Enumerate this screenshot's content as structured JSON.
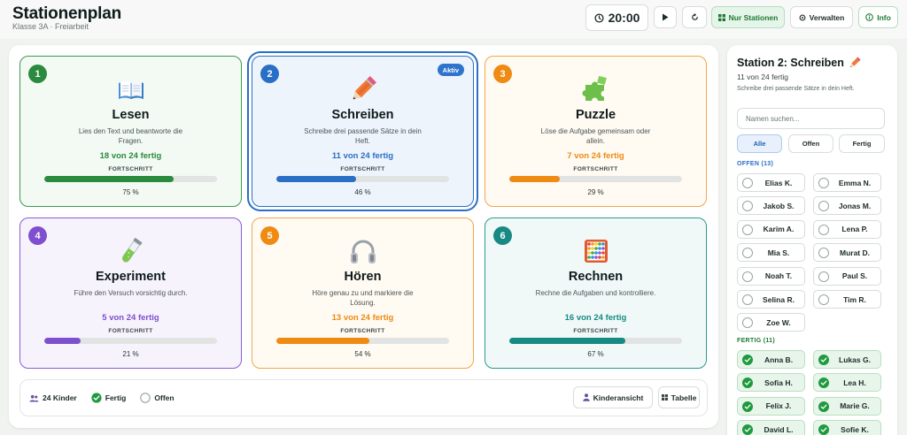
{
  "header": {
    "title": "Stationenplan",
    "subtitle": "Klasse 3A · Freiarbeit",
    "timer": "20:00",
    "only_stations_label": "Nur Stationen",
    "manage_label": "Verwalten",
    "info_label": "Info"
  },
  "stations": [
    {
      "number": "1",
      "name": "Lesen",
      "description": "Lies den Text und beantworte die Fragen.",
      "done_text": "18 von 24 fertig",
      "progress_label": "FORTSCHRITT",
      "percent_text": "75 %",
      "progress": 0.75,
      "icon": "book-icon",
      "color": "#2a8a3e",
      "bg": "#f3faf3",
      "border": "#3c9a4e"
    },
    {
      "number": "2",
      "name": "Schreiben",
      "description": "Schreibe drei passende Sätze in dein Heft.",
      "done_text": "11 von 24 fertig",
      "progress_label": "FORTSCHRITT",
      "percent_text": "46 %",
      "progress": 0.46,
      "icon": "pencil-icon",
      "color": "#2a6fc6",
      "bg": "#eef4fc",
      "border": "#2a6fc6",
      "active": true,
      "active_label": "Aktiv"
    },
    {
      "number": "3",
      "name": "Puzzle",
      "description": "Löse die Aufgabe gemeinsam oder allein.",
      "done_text": "7 von 24 fertig",
      "progress_label": "FORTSCHRITT",
      "percent_text": "29 %",
      "progress": 0.29,
      "icon": "puzzle-icon",
      "color": "#ef8a12",
      "bg": "#fffaf2",
      "border": "#f2a64a"
    },
    {
      "number": "4",
      "name": "Experiment",
      "description": "Führe den Versuch vorsichtig durch.",
      "done_text": "5 von 24 fertig",
      "progress_label": "FORTSCHRITT",
      "percent_text": "21 %",
      "progress": 0.21,
      "icon": "test-tube-icon",
      "color": "#7e4fcf",
      "bg": "#f7f3fd",
      "border": "#8a5bd6"
    },
    {
      "number": "5",
      "name": "Hören",
      "description": "Höre genau zu und markiere die Lösung.",
      "done_text": "13 von 24 fertig",
      "progress_label": "FORTSCHRITT",
      "percent_text": "54 %",
      "progress": 0.54,
      "icon": "headphones-icon",
      "color": "#ef8a12",
      "bg": "#fffaf2",
      "border": "#f2a64a"
    },
    {
      "number": "6",
      "name": "Rechnen",
      "description": "Rechne die Aufgaben und kontrolliere.",
      "done_text": "16 von 24 fertig",
      "progress_label": "FORTSCHRITT",
      "percent_text": "67 %",
      "progress": 0.67,
      "icon": "abacus-icon",
      "color": "#178a83",
      "bg": "#f0f9f8",
      "border": "#2a9a91"
    }
  ],
  "bottom": {
    "kids_count": "24 Kinder",
    "legend_done": "Fertig",
    "legend_open": "Offen",
    "kids_view_label": "Kinderansicht",
    "table_label": "Tabelle"
  },
  "side": {
    "title": "Station 2: Schreiben",
    "count": "11 von 24 fertig",
    "task": "Schreibe drei passende Sätze in dein Heft.",
    "search_placeholder": "Namen suchen...",
    "filters": [
      "Alle",
      "Offen",
      "Fertig"
    ],
    "open_label": "OFFEN (13)",
    "done_label": "FERTIG (11)",
    "open_kids": [
      "Elias K.",
      "Emma N.",
      "Jakob S.",
      "Jonas M.",
      "Karim A.",
      "Lena P.",
      "Mia S.",
      "Murat D.",
      "Noah T.",
      "Paul S.",
      "Selina R.",
      "Tim R.",
      "Zoe W."
    ],
    "done_kids": [
      "Anna B.",
      "Lukas G.",
      "Sofia H.",
      "Lea H.",
      "Felix J.",
      "Marie G.",
      "David L.",
      "Sofie K."
    ]
  }
}
